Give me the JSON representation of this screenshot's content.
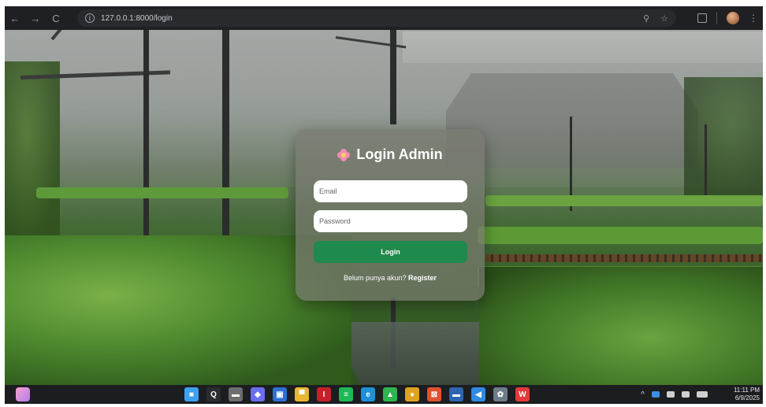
{
  "browser": {
    "url": "127.0.0.1:8000/login",
    "back_glyph": "←",
    "forward_glyph": "→",
    "reload_glyph": "C",
    "info_glyph": "i",
    "zoom_glyph": "⚲",
    "star_glyph": "☆",
    "menu_glyph": "⋮"
  },
  "login": {
    "title": "Login Admin",
    "email_placeholder": "Email",
    "password_placeholder": "Password",
    "button_label": "Login",
    "register_prompt": "Belum punya akun?",
    "register_link": "Register"
  },
  "taskbar": {
    "icons": [
      {
        "name": "windows-start-icon",
        "color": "#3ea1f0",
        "glyph": "■"
      },
      {
        "name": "search-icon",
        "color": "#2b2c30",
        "glyph": "Q"
      },
      {
        "name": "task-view-icon",
        "color": "#6e6e6e",
        "glyph": "▬"
      },
      {
        "name": "copilot-icon",
        "color": "#6a6ef0",
        "glyph": "◆"
      },
      {
        "name": "calendar-icon",
        "color": "#2f6fd1",
        "glyph": "▣"
      },
      {
        "name": "file-explorer-icon",
        "color": "#e8b730",
        "glyph": "▀"
      },
      {
        "name": "app-red-icon",
        "color": "#c8202a",
        "glyph": "I"
      },
      {
        "name": "spotify-icon",
        "color": "#1db954",
        "glyph": "≡"
      },
      {
        "name": "edge-icon",
        "color": "#1f8fd6",
        "glyph": "e"
      },
      {
        "name": "store-badge-icon",
        "color": "#2fb44f",
        "glyph": "▲"
      },
      {
        "name": "chrome-icon",
        "color": "#e0a31f",
        "glyph": "●"
      },
      {
        "name": "app-orange-icon",
        "color": "#e0512f",
        "glyph": "⊠"
      },
      {
        "name": "terminal-icon",
        "color": "#2f64b0",
        "glyph": "▬"
      },
      {
        "name": "vscode-icon",
        "color": "#2f8ae6",
        "glyph": "◀"
      },
      {
        "name": "settings-icon",
        "color": "#6e7c8a",
        "glyph": "✿"
      },
      {
        "name": "wps-icon",
        "color": "#e23a3a",
        "glyph": "W"
      }
    ]
  },
  "tray": {
    "chevron_glyph": "^",
    "time": "11:11 PM",
    "date": "6/9/2025"
  }
}
